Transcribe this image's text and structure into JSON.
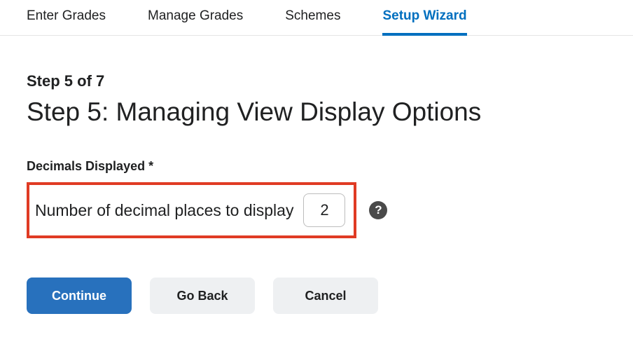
{
  "tabs": [
    {
      "label": "Enter Grades",
      "active": false
    },
    {
      "label": "Manage Grades",
      "active": false
    },
    {
      "label": "Schemes",
      "active": false
    },
    {
      "label": "Setup Wizard",
      "active": true
    }
  ],
  "step": {
    "indicator": "Step 5 of 7",
    "title": "Step 5: Managing View Display Options"
  },
  "section": {
    "label": "Decimals Displayed *",
    "field_label": "Number of decimal places to display",
    "value": "2",
    "help_glyph": "?"
  },
  "buttons": {
    "continue": "Continue",
    "goback": "Go Back",
    "cancel": "Cancel"
  }
}
